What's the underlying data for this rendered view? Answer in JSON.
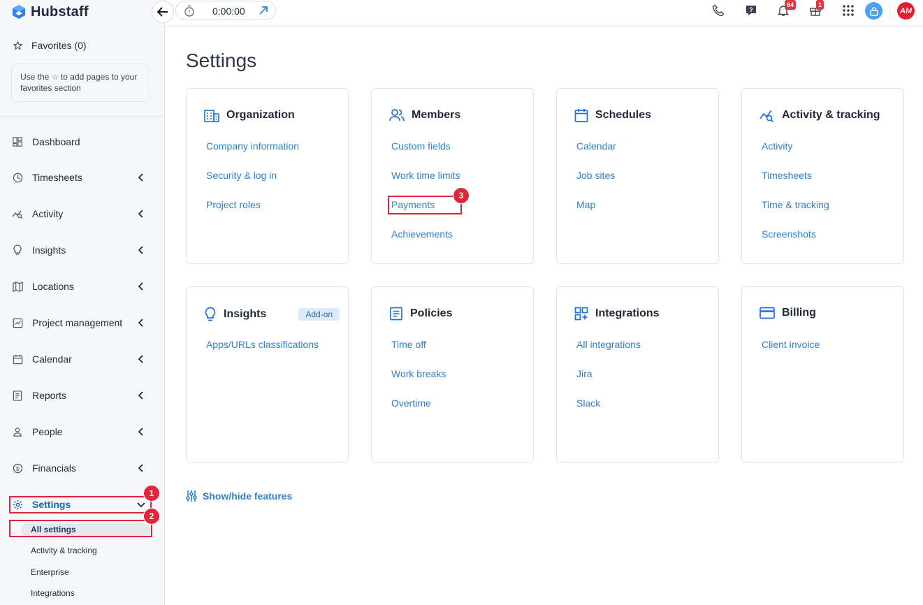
{
  "app": {
    "name": "Hubstaff",
    "colors": {
      "primary": "#2f80c9",
      "brand": "#1f2a44",
      "highlight": "#d9263b",
      "badge": "#e5323e"
    }
  },
  "topbar": {
    "timer_value": "0:00:00",
    "notifications_count": "64",
    "gifts_count": "1",
    "user_initials": "AM",
    "icons": [
      "phone-icon",
      "help-icon",
      "bell-icon",
      "gift-icon",
      "apps-grid-icon",
      "user-icon"
    ]
  },
  "sidebar": {
    "favorites_label": "Favorites (0)",
    "favorites_hint_pre": "Use the",
    "favorites_hint_post": "to add pages to your favorites section",
    "items": [
      {
        "label": "Dashboard",
        "icon": "dashboard-icon"
      },
      {
        "label": "Timesheets",
        "icon": "clock-icon"
      },
      {
        "label": "Activity",
        "icon": "activity-icon"
      },
      {
        "label": "Insights",
        "icon": "lightbulb-icon"
      },
      {
        "label": "Locations",
        "icon": "map-icon"
      },
      {
        "label": "Project management",
        "icon": "project-icon"
      },
      {
        "label": "Calendar",
        "icon": "calendar-icon"
      },
      {
        "label": "Reports",
        "icon": "reports-icon"
      },
      {
        "label": "People",
        "icon": "person-icon"
      },
      {
        "label": "Financials",
        "icon": "dollar-icon"
      },
      {
        "label": "Settings",
        "icon": "gear-icon"
      }
    ],
    "settings_sub": [
      "All settings",
      "Activity & tracking",
      "Enterprise",
      "Integrations"
    ]
  },
  "annotations": [
    "1",
    "2",
    "3"
  ],
  "main": {
    "title": "Settings",
    "cards": [
      {
        "title": "Organization",
        "icon": "building-icon",
        "links": [
          "Company information",
          "Security & log in",
          "Project roles"
        ]
      },
      {
        "title": "Members",
        "icon": "members-icon",
        "links": [
          "Custom fields",
          "Work time limits",
          "Payments",
          "Achievements"
        ]
      },
      {
        "title": "Schedules",
        "icon": "calendar-icon",
        "links": [
          "Calendar",
          "Job sites",
          "Map"
        ]
      },
      {
        "title": "Activity & tracking",
        "icon": "activity-icon",
        "links": [
          "Activity",
          "Timesheets",
          "Time & tracking",
          "Screenshots"
        ]
      },
      {
        "title": "Insights",
        "icon": "lightbulb-icon",
        "badge": "Add-on",
        "links": [
          "Apps/URLs classifications"
        ]
      },
      {
        "title": "Policies",
        "icon": "document-icon",
        "links": [
          "Time off",
          "Work breaks",
          "Overtime"
        ]
      },
      {
        "title": "Integrations",
        "icon": "integrations-icon",
        "links": [
          "All integrations",
          "Jira",
          "Slack"
        ]
      },
      {
        "title": "Billing",
        "icon": "credit-card-icon",
        "links": [
          "Client invoice"
        ]
      }
    ],
    "show_hide_label": "Show/hide features"
  }
}
